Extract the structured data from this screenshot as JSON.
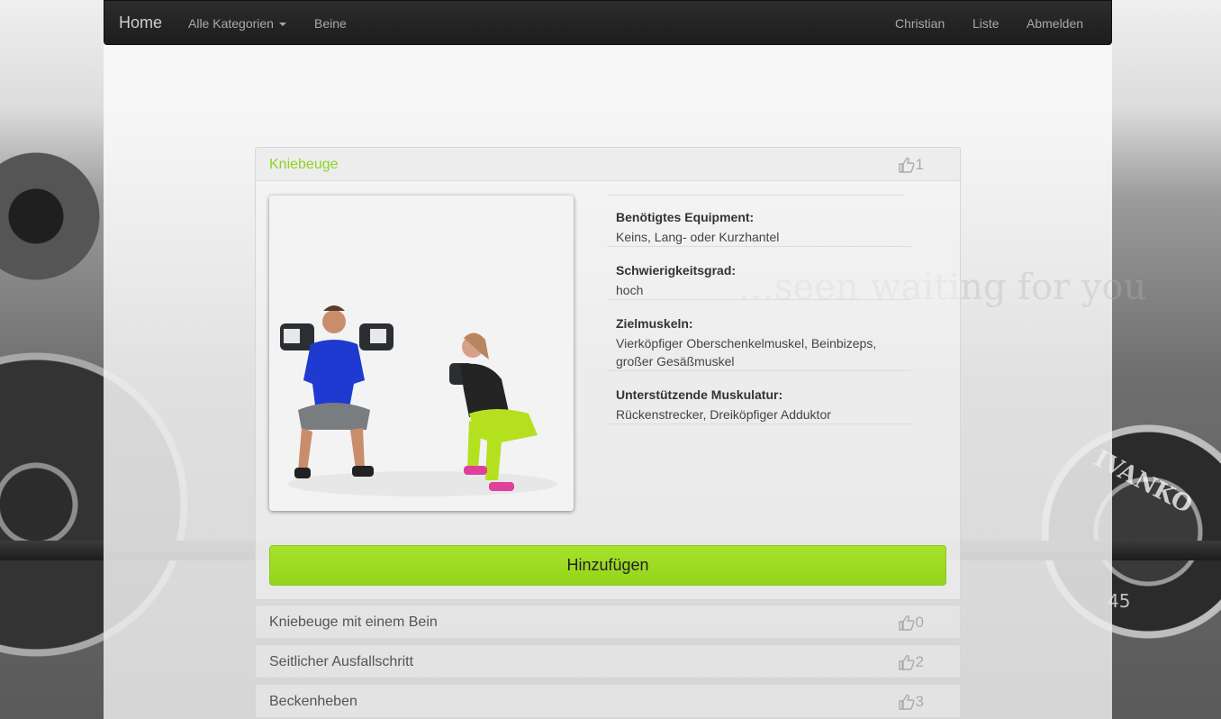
{
  "navbar": {
    "brand": "Home",
    "categories_label": "Alle Kategorien",
    "current_category": "Beine",
    "user": "Christian",
    "list": "Liste",
    "logout": "Abmelden"
  },
  "exercises": [
    {
      "title": "Kniebeuge",
      "likes": "1",
      "expanded": true,
      "details": [
        {
          "label": "Benötigtes Equipment:",
          "value": "Keins, Lang- oder Kurzhantel"
        },
        {
          "label": "Schwierigkeitsgrad:",
          "value": "hoch"
        },
        {
          "label": "Zielmuskeln:",
          "value": "Vierköpfiger Oberschenkelmuskel, Beinbizeps, großer Gesäßmuskel"
        },
        {
          "label": "Unterstützende Muskulatur:",
          "value": "Rückenstrecker, Dreiköpfiger Adduktor"
        }
      ],
      "add_label": "Hinzufügen"
    },
    {
      "title": "Kniebeuge mit einem Bein",
      "likes": "0"
    },
    {
      "title": "Seitlicher Ausfallschritt",
      "likes": "2"
    },
    {
      "title": "Beckenheben",
      "likes": "3"
    }
  ],
  "background": {
    "plate_text": "IVANKO",
    "plate_number": "45",
    "faint_text": "…seen waiting for you"
  },
  "colors": {
    "accent": "#8fd322",
    "button": "#a0dc24",
    "navbar": "#222222"
  }
}
